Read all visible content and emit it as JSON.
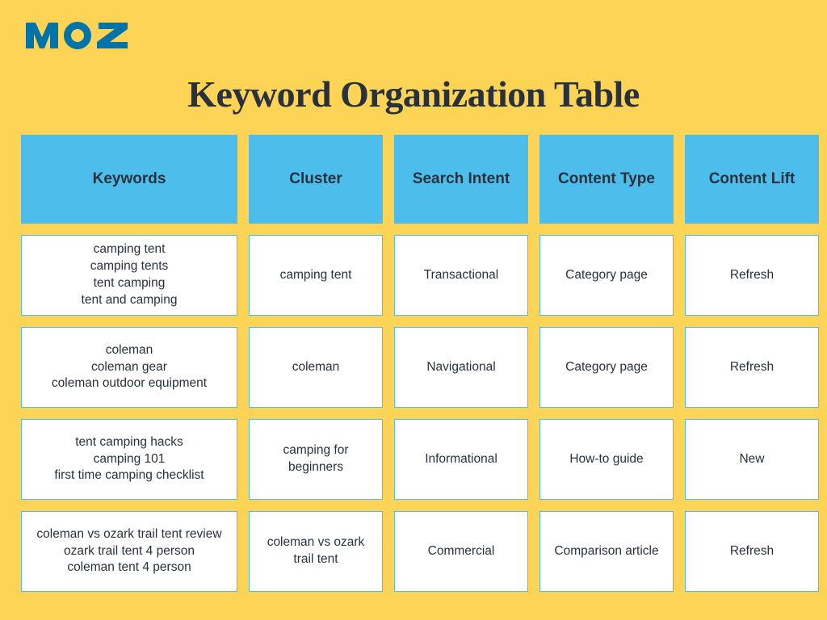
{
  "logo_text": "MOZ",
  "title": "Keyword Organization Table",
  "headers": [
    "Keywords",
    "Cluster",
    "Search Intent",
    "Content Type",
    "Content Lift"
  ],
  "rows": [
    {
      "keywords": [
        "camping tent",
        "camping tents",
        "tent camping",
        "tent and camping"
      ],
      "cluster": "camping tent",
      "search_intent": "Transactional",
      "content_type": "Category page",
      "content_lift": "Refresh"
    },
    {
      "keywords": [
        "coleman",
        "coleman gear",
        "coleman outdoor equipment"
      ],
      "cluster": "coleman",
      "search_intent": "Navigational",
      "content_type": "Category page",
      "content_lift": "Refresh"
    },
    {
      "keywords": [
        "tent camping hacks",
        "camping 101",
        "first time camping checklist"
      ],
      "cluster": "camping for beginners",
      "search_intent": "Informational",
      "content_type": "How-to guide",
      "content_lift": "New"
    },
    {
      "keywords": [
        "coleman vs ozark trail tent review",
        "ozark trail tent 4 person",
        "coleman tent 4 person"
      ],
      "cluster": "coleman vs ozark trail tent",
      "search_intent": "Commercial",
      "content_type": "Comparison article",
      "content_lift": "Refresh"
    }
  ],
  "chart_data": {
    "type": "table",
    "title": "Keyword Organization Table",
    "columns": [
      "Keywords",
      "Cluster",
      "Search Intent",
      "Content Type",
      "Content Lift"
    ],
    "rows": [
      [
        "camping tent; camping tents; tent camping; tent and camping",
        "camping tent",
        "Transactional",
        "Category page",
        "Refresh"
      ],
      [
        "coleman; coleman gear; coleman outdoor equipment",
        "coleman",
        "Navigational",
        "Category page",
        "Refresh"
      ],
      [
        "tent camping hacks; camping 101; first time camping checklist",
        "camping for beginners",
        "Informational",
        "How-to guide",
        "New"
      ],
      [
        "coleman vs ozark trail tent review; ozark trail tent 4 person; coleman tent 4 person",
        "coleman vs ozark trail tent",
        "Commercial",
        "Comparison article",
        "Refresh"
      ]
    ]
  }
}
